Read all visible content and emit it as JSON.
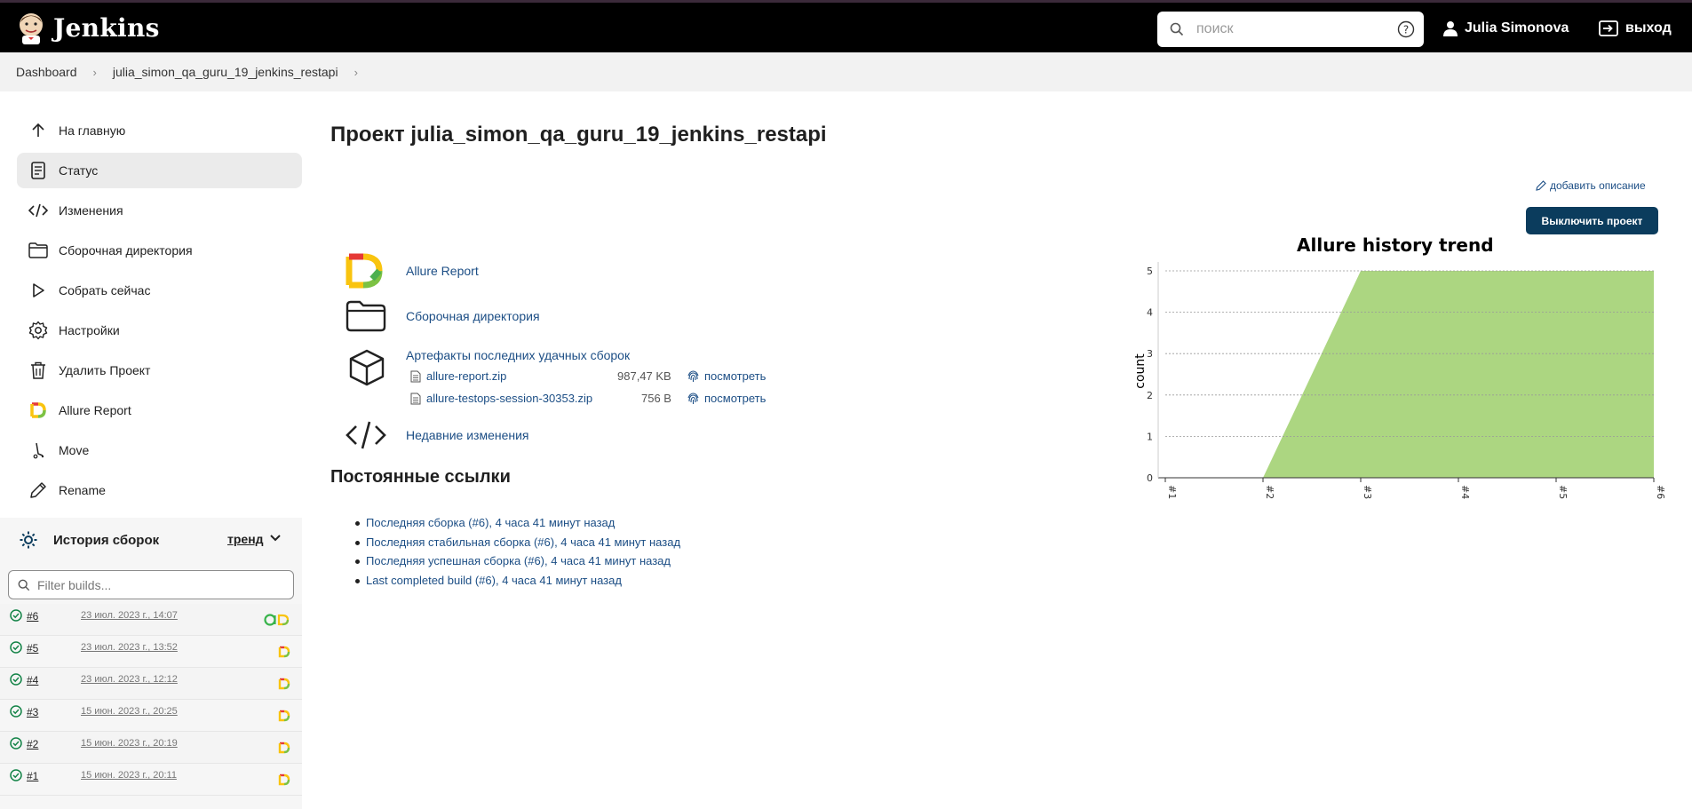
{
  "header": {
    "app_name": "Jenkins",
    "search_placeholder": "поиск",
    "user_name": "Julia Simonova",
    "logout_label": "выход"
  },
  "breadcrumb": {
    "items": [
      "Dashboard",
      "julia_simon_qa_guru_19_jenkins_restapi"
    ]
  },
  "sidebar": {
    "items": [
      {
        "label": "На главную",
        "icon": "arrow-up-icon"
      },
      {
        "label": "Статус",
        "icon": "status-doc-icon",
        "active": true
      },
      {
        "label": "Изменения",
        "icon": "code-icon"
      },
      {
        "label": "Сборочная директория",
        "icon": "folder-icon"
      },
      {
        "label": "Собрать сейчас",
        "icon": "play-icon"
      },
      {
        "label": "Настройки",
        "icon": "gear-icon"
      },
      {
        "label": "Удалить Проект",
        "icon": "trash-icon"
      },
      {
        "label": "Allure Report",
        "icon": "allure-icon"
      },
      {
        "label": "Move",
        "icon": "move-icon"
      },
      {
        "label": "Rename",
        "icon": "pencil-icon"
      }
    ]
  },
  "history": {
    "title": "История сборок",
    "trend_label": "тренд",
    "filter_placeholder": "Filter builds...",
    "builds": [
      {
        "number": "#6",
        "date": "23 июл. 2023 г., 14:07",
        "status": "success"
      },
      {
        "number": "#5",
        "date": "23 июл. 2023 г., 13:52",
        "status": "success"
      },
      {
        "number": "#4",
        "date": "23 июл. 2023 г., 12:12",
        "status": "success"
      },
      {
        "number": "#3",
        "date": "15 июн. 2023 г., 20:25",
        "status": "success"
      },
      {
        "number": "#2",
        "date": "15 июн. 2023 г., 20:19",
        "status": "success"
      },
      {
        "number": "#1",
        "date": "15 июн. 2023 г., 20:11",
        "status": "success"
      }
    ]
  },
  "main": {
    "title": "Проект julia_simon_qa_guru_19_jenkins_restapi",
    "add_description": "добавить описание",
    "disable_button": "Выключить проект",
    "links": {
      "allure": "Allure Report",
      "workspace": "Сборочная директория",
      "artifacts_title": "Артефакты последних удачных сборок",
      "recent_changes": "Недавние изменения"
    },
    "artifacts": [
      {
        "name": "allure-report.zip",
        "size": "987,47 KB",
        "view": "посмотреть"
      },
      {
        "name": "allure-testops-session-30353.zip",
        "size": "756 B",
        "view": "посмотреть"
      }
    ],
    "permalinks_title": "Постоянные ссылки",
    "permalinks": [
      "Последняя сборка (#6), 4 часа 41 минут назад",
      "Последняя стабильная сборка (#6), 4 часа 41 минут назад",
      "Последняя успешная сборка (#6), 4 часа 41 минут назад",
      "Last completed build (#6), 4 часа 41 минут назад"
    ]
  },
  "colors": {
    "header_bg": "#000000",
    "link": "#1c4e85",
    "button_bg": "#0b3c5d",
    "chart_fill": "#acd681",
    "success": "#138347"
  },
  "chart_data": {
    "type": "area",
    "title": "Allure history trend",
    "xlabel": "",
    "ylabel": "count",
    "categories": [
      "#1",
      "#2",
      "#3",
      "#4",
      "#5",
      "#6"
    ],
    "series": [
      {
        "values": [
          null,
          0,
          5,
          5,
          5,
          5
        ]
      }
    ],
    "yticks": [
      0,
      1,
      2,
      3,
      4,
      5
    ],
    "ylim": [
      0,
      5
    ],
    "grid": true
  }
}
